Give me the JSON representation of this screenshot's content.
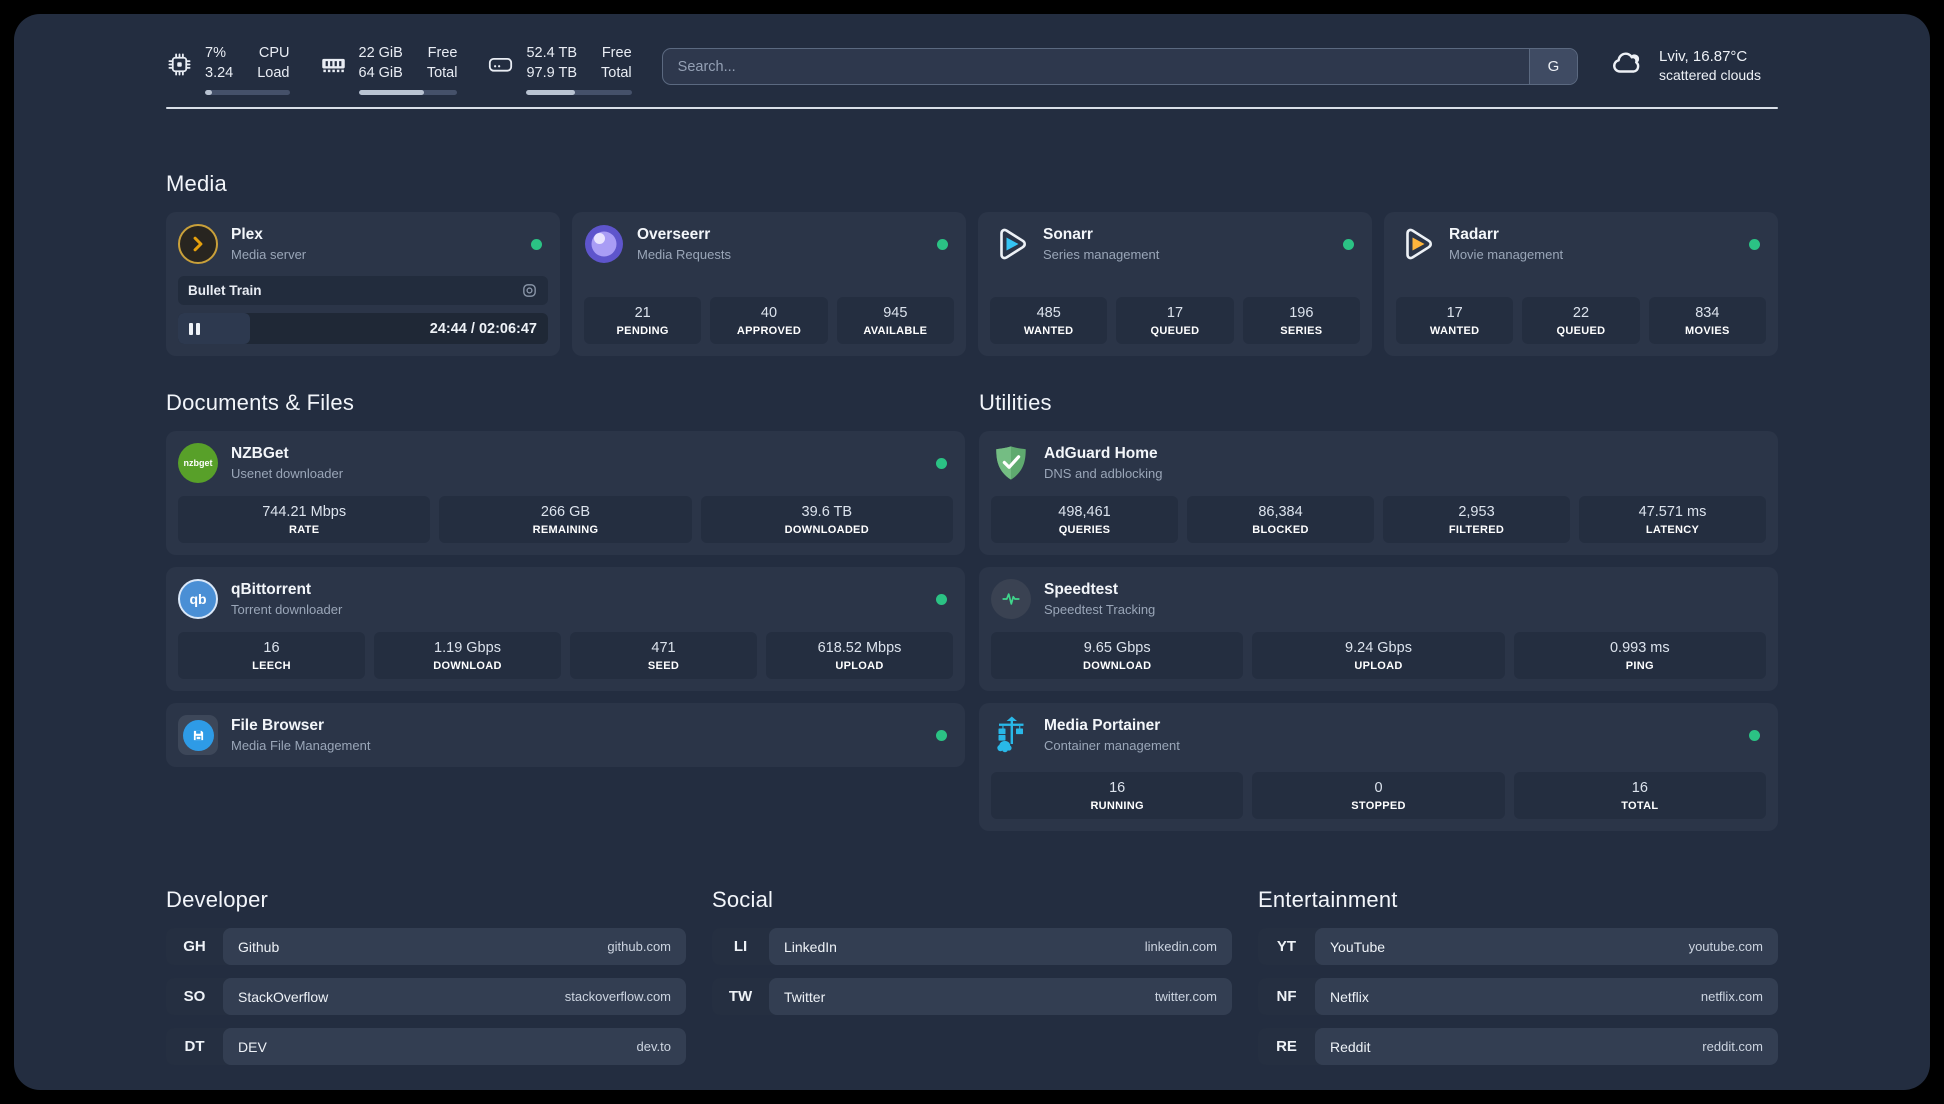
{
  "colors": {
    "panel_bg": "#232d40",
    "card_bg": "#2b3548",
    "status_online": "#2bc284",
    "plex_gold": "#e5a00d",
    "sonarr_blue": "#35c5f4",
    "radarr_gold": "#ffb53c",
    "nzbget_green": "#58a029",
    "qbittorrent_blue": "#4a8fd5",
    "adguard_green": "#67b279",
    "speedtest_green": "#3fd68c",
    "portainer_blue": "#29b8e8",
    "overseerr_purple": "#6f66d9"
  },
  "header": {
    "cpu": {
      "values": [
        "7%",
        "3.24"
      ],
      "labels": [
        "CPU",
        "Load"
      ],
      "progress_pct": 8
    },
    "ram": {
      "values": [
        "22 GiB",
        "64 GiB"
      ],
      "labels": [
        "Free",
        "Total"
      ],
      "progress_pct": 66
    },
    "disk": {
      "values": [
        "52.4 TB",
        "97.9 TB"
      ],
      "labels": [
        "Free",
        "Total"
      ],
      "progress_pct": 46
    },
    "search": {
      "placeholder": "Search...",
      "engine": "G"
    },
    "weather": {
      "line1": "Lviv, 16.87°C",
      "line2": "scattered clouds"
    }
  },
  "media": {
    "title": "Media",
    "plex": {
      "name": "Plex",
      "subtitle": "Media server",
      "now_playing": "Bullet Train",
      "time": "24:44 / 02:06:47",
      "progress_pct": 19.5
    },
    "overseerr": {
      "name": "Overseerr",
      "subtitle": "Media Requests",
      "stats": [
        {
          "v": "21",
          "l": "PENDING"
        },
        {
          "v": "40",
          "l": "APPROVED"
        },
        {
          "v": "945",
          "l": "AVAILABLE"
        }
      ]
    },
    "sonarr": {
      "name": "Sonarr",
      "subtitle": "Series management",
      "stats": [
        {
          "v": "485",
          "l": "WANTED"
        },
        {
          "v": "17",
          "l": "QUEUED"
        },
        {
          "v": "196",
          "l": "SERIES"
        }
      ]
    },
    "radarr": {
      "name": "Radarr",
      "subtitle": "Movie management",
      "stats": [
        {
          "v": "17",
          "l": "WANTED"
        },
        {
          "v": "22",
          "l": "QUEUED"
        },
        {
          "v": "834",
          "l": "MOVIES"
        }
      ]
    }
  },
  "documents": {
    "title": "Documents & Files",
    "nzbget": {
      "name": "NZBGet",
      "subtitle": "Usenet downloader",
      "icon_label": "nzbget",
      "stats": [
        {
          "v": "744.21 Mbps",
          "l": "RATE"
        },
        {
          "v": "266 GB",
          "l": "REMAINING"
        },
        {
          "v": "39.6 TB",
          "l": "DOWNLOADED"
        }
      ]
    },
    "qbittorrent": {
      "name": "qBittorrent",
      "subtitle": "Torrent downloader",
      "icon_label": "qb",
      "stats": [
        {
          "v": "16",
          "l": "LEECH"
        },
        {
          "v": "1.19 Gbps",
          "l": "DOWNLOAD"
        },
        {
          "v": "471",
          "l": "SEED"
        },
        {
          "v": "618.52 Mbps",
          "l": "UPLOAD"
        }
      ]
    },
    "filebrowser": {
      "name": "File Browser",
      "subtitle": "Media File Management"
    }
  },
  "utilities": {
    "title": "Utilities",
    "adguard": {
      "name": "AdGuard Home",
      "subtitle": "DNS and adblocking",
      "stats": [
        {
          "v": "498,461",
          "l": "QUERIES"
        },
        {
          "v": "86,384",
          "l": "BLOCKED"
        },
        {
          "v": "2,953",
          "l": "FILTERED"
        },
        {
          "v": "47.571 ms",
          "l": "LATENCY"
        }
      ]
    },
    "speedtest": {
      "name": "Speedtest",
      "subtitle": "Speedtest Tracking",
      "stats": [
        {
          "v": "9.65 Gbps",
          "l": "DOWNLOAD"
        },
        {
          "v": "9.24 Gbps",
          "l": "UPLOAD"
        },
        {
          "v": "0.993 ms",
          "l": "PING"
        }
      ]
    },
    "portainer": {
      "name": "Media Portainer",
      "subtitle": "Container management",
      "stats": [
        {
          "v": "16",
          "l": "RUNNING"
        },
        {
          "v": "0",
          "l": "STOPPED"
        },
        {
          "v": "16",
          "l": "TOTAL"
        }
      ]
    }
  },
  "bookmarks": [
    {
      "title": "Developer",
      "links": [
        {
          "abbr": "GH",
          "name": "Github",
          "url": "github.com"
        },
        {
          "abbr": "SO",
          "name": "StackOverflow",
          "url": "stackoverflow.com"
        },
        {
          "abbr": "DT",
          "name": "DEV",
          "url": "dev.to"
        }
      ]
    },
    {
      "title": "Social",
      "links": [
        {
          "abbr": "LI",
          "name": "LinkedIn",
          "url": "linkedin.com"
        },
        {
          "abbr": "TW",
          "name": "Twitter",
          "url": "twitter.com"
        }
      ]
    },
    {
      "title": "Entertainment",
      "links": [
        {
          "abbr": "YT",
          "name": "YouTube",
          "url": "youtube.com"
        },
        {
          "abbr": "NF",
          "name": "Netflix",
          "url": "netflix.com"
        },
        {
          "abbr": "RE",
          "name": "Reddit",
          "url": "reddit.com"
        }
      ]
    }
  ]
}
